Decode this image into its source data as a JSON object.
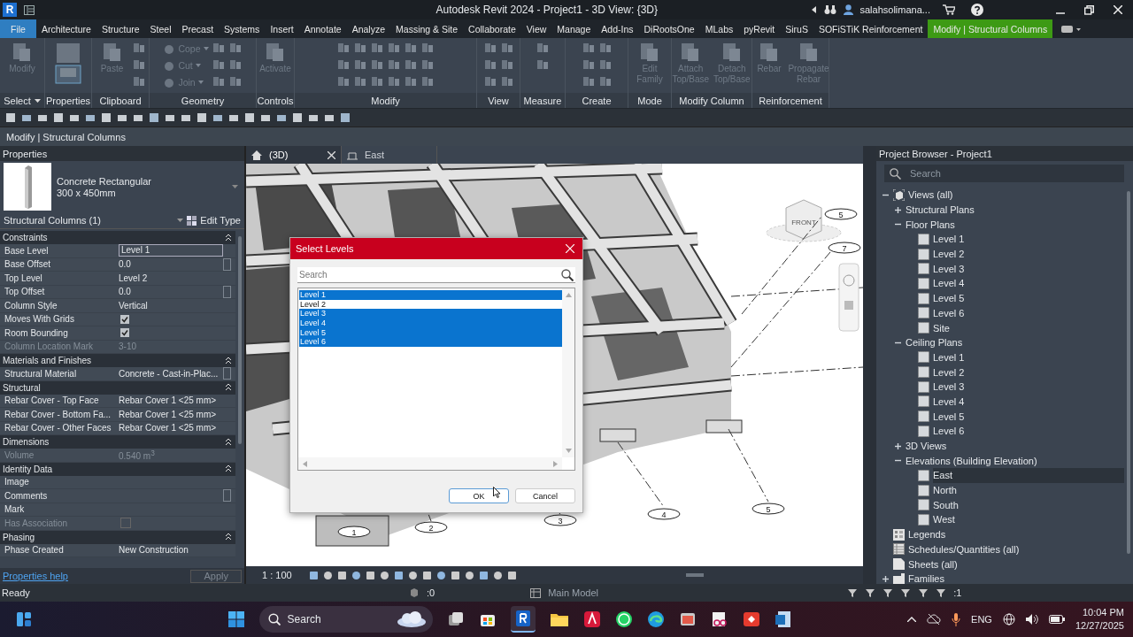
{
  "title_bar": {
    "logo": "R",
    "title": "Autodesk Revit 2024 - Project1 - 3D View: {3D}",
    "user": "salahsolimana..."
  },
  "ribbon_tabs": [
    {
      "label": "File",
      "kind": "file",
      "selected": false
    },
    {
      "label": "Architecture",
      "kind": "tab",
      "selected": false
    },
    {
      "label": "Structure",
      "kind": "tab",
      "selected": false
    },
    {
      "label": "Steel",
      "kind": "tab",
      "selected": false
    },
    {
      "label": "Precast",
      "kind": "tab",
      "selected": false
    },
    {
      "label": "Systems",
      "kind": "tab",
      "selected": false
    },
    {
      "label": "Insert",
      "kind": "tab",
      "selected": false
    },
    {
      "label": "Annotate",
      "kind": "tab",
      "selected": false
    },
    {
      "label": "Analyze",
      "kind": "tab",
      "selected": false
    },
    {
      "label": "Massing & Site",
      "kind": "tab",
      "selected": false
    },
    {
      "label": "Collaborate",
      "kind": "tab",
      "selected": false
    },
    {
      "label": "View",
      "kind": "tab",
      "selected": false
    },
    {
      "label": "Manage",
      "kind": "tab",
      "selected": false
    },
    {
      "label": "Add-Ins",
      "kind": "tab",
      "selected": false
    },
    {
      "label": "DiRootsOne",
      "kind": "tab",
      "selected": false
    },
    {
      "label": "MLabs",
      "kind": "tab",
      "selected": false
    },
    {
      "label": "pyRevit",
      "kind": "tab",
      "selected": false
    },
    {
      "label": "SiruS",
      "kind": "tab",
      "selected": false
    },
    {
      "label": "SOFiSTiK Reinforcement",
      "kind": "tab",
      "selected": false
    },
    {
      "label": "Modify | Structural Columns",
      "kind": "context",
      "selected": true
    }
  ],
  "ribbon_panels": [
    {
      "title": "Select",
      "dropdown": true,
      "buttons": [
        {
          "label": "Modify"
        }
      ]
    },
    {
      "title": "Properties",
      "dropdown": false
    },
    {
      "title": "Clipboard",
      "dropdown": false,
      "buttons": [
        {
          "label": "Paste"
        }
      ]
    },
    {
      "title": "Geometry",
      "dropdown": false,
      "small": [
        "Cope",
        "Cut",
        "Join"
      ]
    },
    {
      "title": "Controls",
      "dropdown": false,
      "buttons": [
        {
          "label": "Activate"
        }
      ]
    },
    {
      "title": "Modify",
      "dropdown": false
    },
    {
      "title": "View",
      "dropdown": false
    },
    {
      "title": "Measure",
      "dropdown": false
    },
    {
      "title": "Create",
      "dropdown": false
    },
    {
      "title": "Mode",
      "dropdown": false,
      "buttons": [
        {
          "label": "Edit Family"
        }
      ]
    },
    {
      "title": "Modify Column",
      "dropdown": false,
      "buttons": [
        {
          "label": "Attach Top/Base"
        },
        {
          "label": "Detach Top/Base"
        }
      ]
    },
    {
      "title": "Reinforcement",
      "dropdown": false,
      "buttons": [
        {
          "label": "Rebar"
        },
        {
          "label": "Propagate Rebar"
        }
      ]
    }
  ],
  "context_bar": "Modify | Structural Columns",
  "properties": {
    "title": "Properties",
    "type_name": "Concrete Rectangular",
    "type_size": "300 x 450mm",
    "selector": "Structural Columns (1)",
    "edit_type": "Edit Type",
    "groups": [
      {
        "title": "Constraints",
        "rows": [
          {
            "label": "Base Level",
            "value": "Level 1",
            "kind": "field",
            "button": false,
            "disabled": false
          },
          {
            "label": "Base Offset",
            "value": "0.0",
            "kind": "text",
            "button": true,
            "disabled": false
          },
          {
            "label": "Top Level",
            "value": "Level 2",
            "kind": "text",
            "button": false,
            "disabled": false
          },
          {
            "label": "Top Offset",
            "value": "0.0",
            "kind": "text",
            "button": true,
            "disabled": false
          },
          {
            "label": "Column Style",
            "value": "Vertical",
            "kind": "text",
            "button": false,
            "disabled": false
          },
          {
            "label": "Moves With Grids",
            "kind": "check",
            "checked": true,
            "button": false,
            "disabled": false
          },
          {
            "label": "Room Bounding",
            "kind": "check",
            "checked": true,
            "button": false,
            "disabled": false
          },
          {
            "label": "Column Location Mark",
            "value": "3-10",
            "kind": "text",
            "button": false,
            "disabled": true
          }
        ]
      },
      {
        "title": "Materials and Finishes",
        "rows": [
          {
            "label": "Structural Material",
            "value": "Concrete - Cast-in-Plac...",
            "kind": "text",
            "button": true,
            "disabled": false
          }
        ]
      },
      {
        "title": "Structural",
        "rows": [
          {
            "label": "Rebar Cover - Top Face",
            "value": "Rebar Cover 1 <25 mm>",
            "kind": "text",
            "button": false,
            "disabled": false
          },
          {
            "label": "Rebar Cover - Bottom Fa...",
            "value": "Rebar Cover 1 <25 mm>",
            "kind": "text",
            "button": false,
            "disabled": false
          },
          {
            "label": "Rebar Cover - Other Faces",
            "value": "Rebar Cover 1 <25 mm>",
            "kind": "text",
            "button": false,
            "disabled": false
          }
        ]
      },
      {
        "title": "Dimensions",
        "rows": [
          {
            "label": "Volume",
            "value": "0.540 m$^{3}$",
            "kind": "text",
            "button": false,
            "disabled": true
          }
        ]
      },
      {
        "title": "Identity Data",
        "rows": [
          {
            "label": "Image",
            "kind": "text",
            "button": false,
            "disabled": false
          },
          {
            "label": "Comments",
            "kind": "text",
            "button": true,
            "disabled": false
          },
          {
            "label": "Mark",
            "kind": "text",
            "button": false,
            "disabled": false
          },
          {
            "label": "Has Association",
            "kind": "check",
            "checked": false,
            "button": false,
            "disabled": true
          }
        ]
      },
      {
        "title": "Phasing",
        "rows": [
          {
            "label": "Phase Created",
            "value": "New Construction",
            "kind": "text",
            "button": false,
            "disabled": false
          }
        ]
      }
    ],
    "help": "Properties help",
    "apply": "Apply"
  },
  "view_tabs": [
    {
      "label": "(3D)",
      "kind": "perspective",
      "selected": true
    },
    {
      "label": "East",
      "kind": "elevation",
      "selected": false
    }
  ],
  "view": {
    "cube_label": "FRONT",
    "grid_bubbles": [
      "1",
      "2",
      "3",
      "4",
      "5",
      "5",
      "7"
    ],
    "scale": "1 : 100"
  },
  "dialog": {
    "title": "Select Levels",
    "search_placeholder": "Search",
    "items": [
      {
        "label": "Level 1",
        "selected": true
      },
      {
        "label": "Level 2",
        "selected": false
      },
      {
        "label": "Level 3",
        "selected": true
      },
      {
        "label": "Level 4",
        "selected": true
      },
      {
        "label": "Level 5",
        "selected": true
      },
      {
        "label": "Level 6",
        "selected": true
      }
    ],
    "buttons": [
      {
        "label": "OK",
        "default": true
      },
      {
        "label": "Cancel",
        "default": false
      }
    ]
  },
  "project_browser": {
    "title": "Project Browser - Project1",
    "search_placeholder": "Search",
    "tree": [
      {
        "label": "Views (all)",
        "kind": "views",
        "expanded": true,
        "selected": false,
        "children": [
          {
            "label": "Structural Plans",
            "expanded": false,
            "selected": false
          },
          {
            "label": "Floor Plans",
            "expanded": true,
            "selected": false,
            "children": [
              {
                "label": "Level 1",
                "kind": "view",
                "selected": false
              },
              {
                "label": "Level 2",
                "kind": "view",
                "selected": false
              },
              {
                "label": "Level 3",
                "kind": "view",
                "selected": false
              },
              {
                "label": "Level 4",
                "kind": "view",
                "selected": false
              },
              {
                "label": "Level 5",
                "kind": "view",
                "selected": false
              },
              {
                "label": "Level 6",
                "kind": "view",
                "selected": false
              },
              {
                "label": "Site",
                "kind": "view",
                "selected": false
              }
            ]
          },
          {
            "label": "Ceiling Plans",
            "expanded": true,
            "selected": false,
            "children": [
              {
                "label": "Level 1",
                "kind": "view",
                "selected": false
              },
              {
                "label": "Level 2",
                "kind": "view",
                "selected": false
              },
              {
                "label": "Level 3",
                "kind": "view",
                "selected": false
              },
              {
                "label": "Level 4",
                "kind": "view",
                "selected": false
              },
              {
                "label": "Level 5",
                "kind": "view",
                "selected": false
              },
              {
                "label": "Level 6",
                "kind": "view",
                "selected": false
              }
            ]
          },
          {
            "label": "3D Views",
            "expanded": false,
            "selected": false
          },
          {
            "label": "Elevations (Building Elevation)",
            "expanded": true,
            "selected": false,
            "children": [
              {
                "label": "East",
                "kind": "view",
                "selected": true
              },
              {
                "label": "North",
                "kind": "view",
                "selected": false
              },
              {
                "label": "South",
                "kind": "view",
                "selected": false
              },
              {
                "label": "West",
                "kind": "view",
                "selected": false
              }
            ]
          }
        ]
      },
      {
        "label": "Legends",
        "kind": "legends",
        "selected": false
      },
      {
        "label": "Schedules/Quantities (all)",
        "kind": "schedules",
        "selected": false
      },
      {
        "label": "Sheets (all)",
        "kind": "sheets",
        "selected": false
      },
      {
        "label": "Families",
        "kind": "families",
        "expanded": false,
        "selected": false
      }
    ]
  },
  "status_bar": {
    "text": "Ready",
    "selection_count": ":0",
    "model": "Main Model",
    "filter_count": ":1"
  },
  "taskbar": {
    "search": "Search",
    "language": "ENG",
    "time": "10:04 PM",
    "date": "12/27/2025"
  }
}
